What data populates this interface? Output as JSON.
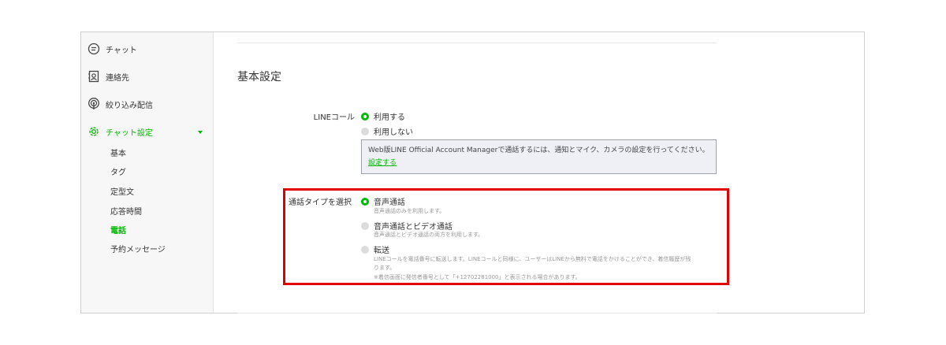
{
  "sidebar": {
    "items": [
      {
        "label": "チャット",
        "icon": "chat-bubble-icon"
      },
      {
        "label": "連絡先",
        "icon": "contacts-icon"
      },
      {
        "label": "絞り込み配信",
        "icon": "broadcast-icon"
      },
      {
        "label": "チャット設定",
        "icon": "gear-icon"
      }
    ],
    "sub_items": [
      "基本",
      "タグ",
      "定型文",
      "応答時間",
      "電話",
      "予約メッセージ"
    ]
  },
  "main": {
    "section_title": "基本設定",
    "line_call": {
      "label": "LINEコール",
      "options": [
        "利用する",
        "利用しない"
      ],
      "selected": "利用する",
      "notice_text": "Web版LINE Official Account Managerで通話するには、通知とマイク、カメラの設定を行ってください。",
      "notice_link": "設定する"
    },
    "call_type": {
      "label": "通話タイプを選択",
      "selected": "音声通話",
      "options": [
        {
          "label": "音声通話",
          "hint": "音声通話のみを利用します。"
        },
        {
          "label": "音声通話とビデオ通話",
          "hint": "音声通話とビデオ通話の両方を利用します。"
        },
        {
          "label": "転送",
          "hint_line1": "LINEコールを電話番号に転送します。LINEコールと同様に、ユーザーはLINEから無料で電話をかけることができ、着信履歴が残",
          "hint_line2": "ります。",
          "hint_line3": "※着信画面に発信者番号として「+12702281000」と表示される場合があります。"
        }
      ]
    }
  },
  "colors": {
    "accent": "#00b900",
    "highlight": "#e00000"
  }
}
